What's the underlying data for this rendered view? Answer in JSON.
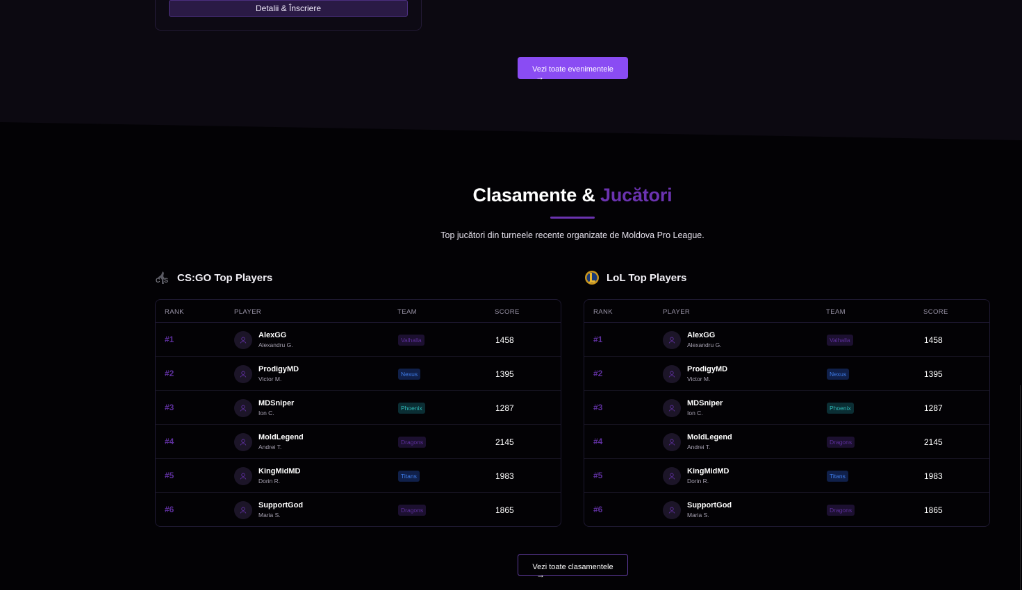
{
  "events": {
    "card_button": "Detalii & Înscriere",
    "all_button": "Vezi toate evenimentele",
    "arrow": "→"
  },
  "section": {
    "title_main": "Clasamente & ",
    "title_accent": "Jucători",
    "subtitle": "Top jucători din turneele recente organizate de Moldova Pro League."
  },
  "colors": {
    "accent": "#6b33b0",
    "button": "#8a4cf3",
    "teams": {
      "Valhalla": {
        "bg": "#1c1030",
        "fg": "#5d2f9c"
      },
      "Nexus": {
        "bg": "#10204a",
        "fg": "#3f7dea"
      },
      "Phoenix": {
        "bg": "#0b2e34",
        "fg": "#2fb6b4"
      },
      "Dragons": {
        "bg": "#1c1030",
        "fg": "#5d2f9c"
      },
      "Titans": {
        "bg": "#10204a",
        "fg": "#3f7dea"
      }
    }
  },
  "headers": {
    "rank": "RANK",
    "player": "PLAYER",
    "team": "TEAM",
    "score": "SCORE"
  },
  "csgo": {
    "title": "CS:GO Top Players",
    "icon": "csgo-icon",
    "rows": [
      {
        "rank": "#1",
        "name": "AlexGG",
        "real": "Alexandru G.",
        "team": "Valhalla",
        "score": "1458"
      },
      {
        "rank": "#2",
        "name": "ProdigyMD",
        "real": "Victor M.",
        "team": "Nexus",
        "score": "1395"
      },
      {
        "rank": "#3",
        "name": "MDSniper",
        "real": "Ion C.",
        "team": "Phoenix",
        "score": "1287"
      },
      {
        "rank": "#4",
        "name": "MoldLegend",
        "real": "Andrei T.",
        "team": "Dragons",
        "score": "2145"
      },
      {
        "rank": "#5",
        "name": "KingMidMD",
        "real": "Dorin R.",
        "team": "Titans",
        "score": "1983"
      },
      {
        "rank": "#6",
        "name": "SupportGod",
        "real": "Maria S.",
        "team": "Dragons",
        "score": "1865"
      }
    ]
  },
  "lol": {
    "title": "LoL Top Players",
    "icon": "lol-icon",
    "rows": [
      {
        "rank": "#1",
        "name": "AlexGG",
        "real": "Alexandru G.",
        "team": "Valhalla",
        "score": "1458"
      },
      {
        "rank": "#2",
        "name": "ProdigyMD",
        "real": "Victor M.",
        "team": "Nexus",
        "score": "1395"
      },
      {
        "rank": "#3",
        "name": "MDSniper",
        "real": "Ion C.",
        "team": "Phoenix",
        "score": "1287"
      },
      {
        "rank": "#4",
        "name": "MoldLegend",
        "real": "Andrei T.",
        "team": "Dragons",
        "score": "2145"
      },
      {
        "rank": "#5",
        "name": "KingMidMD",
        "real": "Dorin R.",
        "team": "Titans",
        "score": "1983"
      },
      {
        "rank": "#6",
        "name": "SupportGod",
        "real": "Maria S.",
        "team": "Dragons",
        "score": "1865"
      }
    ]
  },
  "rankings": {
    "all_button": "Vezi toate clasamentele",
    "arrow": "→"
  }
}
